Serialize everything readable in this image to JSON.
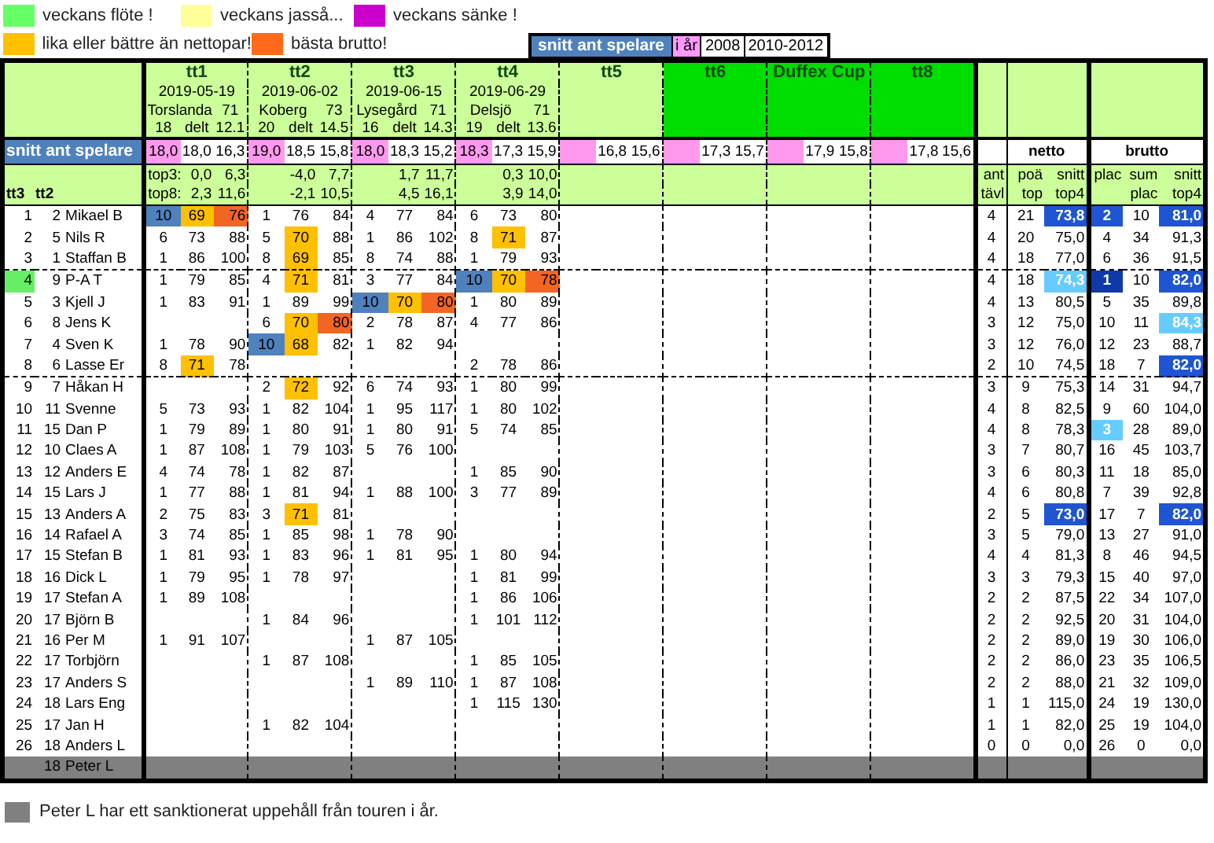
{
  "legend_rows": [
    [
      {
        "label": "veckans flöte !",
        "color": "#66ff66"
      },
      {
        "label": "veckans jasså...",
        "color": "#ffff99"
      },
      {
        "label": "veckans sänke !",
        "color": "#cc00cc"
      }
    ],
    [
      {
        "label": "lika eller bättre än nettopar!",
        "color": "#ffc000"
      },
      {
        "label": "bästa brutto!",
        "color": "#ff6a1a"
      }
    ]
  ],
  "snitt_key": {
    "title": "snitt ant spelare",
    "items": [
      {
        "label": "i år",
        "color": "#ff99ff"
      },
      {
        "label": "2008",
        "color": "#ffffff"
      },
      {
        "label": "2010-2012",
        "color": "#ffffff"
      }
    ]
  },
  "left_header": {
    "snitt_label": "snitt ant spelare",
    "rank_label": "tt3",
    "tt2_label": "tt2"
  },
  "tournaments": [
    {
      "name": "tt1",
      "highlighted": false,
      "date": "2019-05-19",
      "course": "Torslanda",
      "par": "71",
      "players": "18",
      "delt": "delt",
      "hcp": "12.1",
      "snitt_i_ar": "18,0",
      "snitt_2008": "18,0",
      "snitt_2010_2012": "16,3",
      "top3_label": "top3:",
      "top3": [
        "0,0",
        "6,3"
      ],
      "top8_label": "top8:",
      "top8": [
        "2,3",
        "11,6"
      ]
    },
    {
      "name": "tt2",
      "highlighted": false,
      "date": "2019-06-02",
      "course": "Koberg",
      "par": "73",
      "players": "20",
      "delt": "delt",
      "hcp": "14.5",
      "snitt_i_ar": "19,0",
      "snitt_2008": "18,5",
      "snitt_2010_2012": "15,8",
      "top3": [
        "-4,0",
        "7,7"
      ],
      "top8": [
        "-2,1",
        "10,5"
      ]
    },
    {
      "name": "tt3",
      "highlighted": false,
      "date": "2019-06-15",
      "course": "Lysegård",
      "par": "71",
      "players": "16",
      "delt": "delt",
      "hcp": "14.3",
      "snitt_i_ar": "18,0",
      "snitt_2008": "18,3",
      "snitt_2010_2012": "15,2",
      "top3": [
        "1,7",
        "11,7"
      ],
      "top8": [
        "4,5",
        "16,1"
      ]
    },
    {
      "name": "tt4",
      "highlighted": false,
      "date": "2019-06-29",
      "course": "Delsjö",
      "par": "71",
      "players": "19",
      "delt": "delt",
      "hcp": "13.6",
      "snitt_i_ar": "18,3",
      "snitt_2008": "17,3",
      "snitt_2010_2012": "15,9",
      "top3": [
        "0,3",
        "10,0"
      ],
      "top8": [
        "3,9",
        "14,0"
      ]
    },
    {
      "name": "tt5",
      "highlighted": false,
      "snitt_2008": "16,8",
      "snitt_2010_2012": "15,6"
    },
    {
      "name": "tt6",
      "highlighted": true,
      "snitt_2008": "17,3",
      "snitt_2010_2012": "15,7"
    },
    {
      "name": "Duffex Cup",
      "highlighted": true,
      "snitt_2008": "17,9",
      "snitt_2010_2012": "15,8"
    },
    {
      "name": "tt8",
      "highlighted": true,
      "snitt_2008": "17,8",
      "snitt_2010_2012": "15,6"
    }
  ],
  "summary_header": {
    "ant": {
      "top": "ant",
      "bottom": "tävl"
    },
    "netto": {
      "title": "netto",
      "columns": [
        {
          "top": "poä",
          "bottom": "top"
        },
        {
          "top": "snitt",
          "bottom": "top4"
        }
      ]
    },
    "brutto": {
      "title": "brutto",
      "columns": [
        {
          "top": "plac"
        },
        {
          "top": "sum",
          "bottom": "plac"
        },
        {
          "top": "snitt",
          "bottom": "top4"
        }
      ]
    }
  },
  "groups": [
    {
      "rows": [
        {
          "rank": "1",
          "tt2": "2",
          "name": "Mikael B",
          "flote": false,
          "sanctioned": false,
          "results": [
            {
              "kind": "result",
              "place": "10",
              "netto": "69",
              "brutto": "76",
              "top_place": true,
              "under_par": true,
              "best_brutto": true
            },
            {
              "kind": "result",
              "place": "1",
              "netto": "76",
              "brutto": "84",
              "top_place": false,
              "under_par": false,
              "best_brutto": false
            },
            {
              "kind": "result",
              "place": "4",
              "netto": "77",
              "brutto": "84",
              "top_place": false,
              "under_par": false,
              "best_brutto": false
            },
            {
              "kind": "result",
              "place": "6",
              "netto": "73",
              "brutto": "80",
              "top_place": false,
              "under_par": false,
              "best_brutto": false
            }
          ],
          "ant": "4",
          "poa": "21",
          "netto_snitt": {
            "value": "73,8",
            "color": "#1f55d2"
          },
          "plac": {
            "value": "2",
            "color": "#1f55d2"
          },
          "sum_plac": "10",
          "brutto_snitt": {
            "value": "81,0",
            "color": "#1f55d2"
          }
        },
        {
          "rank": "2",
          "tt2": "5",
          "name": "Nils R",
          "flote": false,
          "sanctioned": false,
          "results": [
            {
              "kind": "result",
              "place": "6",
              "netto": "73",
              "brutto": "88",
              "top_place": false,
              "under_par": false,
              "best_brutto": false
            },
            {
              "kind": "result",
              "place": "5",
              "netto": "70",
              "brutto": "88",
              "top_place": false,
              "under_par": true,
              "best_brutto": false
            },
            {
              "kind": "result",
              "place": "1",
              "netto": "86",
              "brutto": "102",
              "top_place": false,
              "under_par": false,
              "best_brutto": false
            },
            {
              "kind": "result",
              "place": "8",
              "netto": "71",
              "brutto": "87",
              "top_place": false,
              "under_par": true,
              "best_brutto": false
            }
          ],
          "ant": "4",
          "poa": "20",
          "netto_snitt": {
            "value": "75,0"
          },
          "plac": {
            "value": "4"
          },
          "sum_plac": "34",
          "brutto_snitt": {
            "value": "91,3"
          }
        },
        {
          "rank": "3",
          "tt2": "1",
          "name": "Staffan B",
          "flote": false,
          "sanctioned": false,
          "results": [
            {
              "kind": "result",
              "place": "1",
              "netto": "86",
              "brutto": "100",
              "top_place": false,
              "under_par": false,
              "best_brutto": false
            },
            {
              "kind": "result",
              "place": "8",
              "netto": "69",
              "brutto": "85",
              "top_place": false,
              "under_par": true,
              "best_brutto": false
            },
            {
              "kind": "result",
              "place": "8",
              "netto": "74",
              "brutto": "88",
              "top_place": false,
              "under_par": false,
              "best_brutto": false
            },
            {
              "kind": "result",
              "place": "1",
              "netto": "79",
              "brutto": "93",
              "top_place": false,
              "under_par": false,
              "best_brutto": false
            }
          ],
          "ant": "4",
          "poa": "18",
          "netto_snitt": {
            "value": "77,0"
          },
          "plac": {
            "value": "6"
          },
          "sum_plac": "36",
          "brutto_snitt": {
            "value": "91,5"
          }
        }
      ]
    },
    {
      "rows": [
        {
          "rank": "4",
          "tt2": "9",
          "name": "P-A T",
          "flote": true,
          "sanctioned": false,
          "results": [
            {
              "kind": "result",
              "place": "1",
              "netto": "79",
              "brutto": "85",
              "top_place": false,
              "under_par": false,
              "best_brutto": false
            },
            {
              "kind": "result",
              "place": "4",
              "netto": "71",
              "brutto": "81",
              "top_place": false,
              "under_par": true,
              "best_brutto": false
            },
            {
              "kind": "result",
              "place": "3",
              "netto": "77",
              "brutto": "84",
              "top_place": false,
              "under_par": false,
              "best_brutto": false
            },
            {
              "kind": "result",
              "place": "10",
              "netto": "70",
              "brutto": "78",
              "top_place": true,
              "under_par": true,
              "best_brutto": true
            }
          ],
          "ant": "4",
          "poa": "18",
          "netto_snitt": {
            "value": "74,3",
            "color": "#66ccff"
          },
          "plac": {
            "value": "1",
            "color": "#0d3aa8"
          },
          "sum_plac": "10",
          "brutto_snitt": {
            "value": "82,0",
            "color": "#1f55d2"
          }
        },
        {
          "rank": "5",
          "tt2": "3",
          "name": "Kjell J",
          "flote": false,
          "sanctioned": false,
          "results": [
            {
              "kind": "result",
              "place": "1",
              "netto": "83",
              "brutto": "91",
              "top_place": false,
              "under_par": false,
              "best_brutto": false
            },
            {
              "kind": "result",
              "place": "1",
              "netto": "89",
              "brutto": "99",
              "top_place": false,
              "under_par": false,
              "best_brutto": false
            },
            {
              "kind": "result",
              "place": "10",
              "netto": "70",
              "brutto": "80",
              "top_place": true,
              "under_par": true,
              "best_brutto": true
            },
            {
              "kind": "result",
              "place": "1",
              "netto": "80",
              "brutto": "89",
              "top_place": false,
              "under_par": false,
              "best_brutto": false
            }
          ],
          "ant": "4",
          "poa": "13",
          "netto_snitt": {
            "value": "80,5"
          },
          "plac": {
            "value": "5"
          },
          "sum_plac": "35",
          "brutto_snitt": {
            "value": "89,8"
          }
        },
        {
          "rank": "6",
          "tt2": "8",
          "name": "Jens K",
          "flote": false,
          "sanctioned": false,
          "results": [
            {
              "kind": "none"
            },
            {
              "kind": "result",
              "place": "6",
              "netto": "70",
              "brutto": "80",
              "top_place": false,
              "under_par": true,
              "best_brutto": true
            },
            {
              "kind": "result",
              "place": "2",
              "netto": "78",
              "brutto": "87",
              "top_place": false,
              "under_par": false,
              "best_brutto": false
            },
            {
              "kind": "result",
              "place": "4",
              "netto": "77",
              "brutto": "86",
              "top_place": false,
              "under_par": false,
              "best_brutto": false
            }
          ],
          "ant": "3",
          "poa": "12",
          "netto_snitt": {
            "value": "75,0"
          },
          "plac": {
            "value": "10"
          },
          "sum_plac": "11",
          "brutto_snitt": {
            "value": "84,3",
            "color": "#66ccff"
          }
        },
        {
          "rank": "7",
          "tt2": "4",
          "name": "Sven K",
          "flote": false,
          "sanctioned": false,
          "results": [
            {
              "kind": "result",
              "place": "1",
              "netto": "78",
              "brutto": "90",
              "top_place": false,
              "under_par": false,
              "best_brutto": false
            },
            {
              "kind": "result",
              "place": "10",
              "netto": "68",
              "brutto": "82",
              "top_place": true,
              "under_par": true,
              "best_brutto": false
            },
            {
              "kind": "result",
              "place": "1",
              "netto": "82",
              "brutto": "94",
              "top_place": false,
              "under_par": false,
              "best_brutto": false
            },
            {
              "kind": "none"
            }
          ],
          "ant": "3",
          "poa": "12",
          "netto_snitt": {
            "value": "76,0"
          },
          "plac": {
            "value": "12"
          },
          "sum_plac": "23",
          "brutto_snitt": {
            "value": "88,7"
          }
        },
        {
          "rank": "8",
          "tt2": "6",
          "name": "Lasse Er",
          "flote": false,
          "sanctioned": false,
          "results": [
            {
              "kind": "result",
              "place": "8",
              "netto": "71",
              "brutto": "78",
              "top_place": false,
              "under_par": true,
              "best_brutto": false
            },
            {
              "kind": "none"
            },
            {
              "kind": "none"
            },
            {
              "kind": "result",
              "place": "2",
              "netto": "78",
              "brutto": "86",
              "top_place": false,
              "under_par": false,
              "best_brutto": false
            }
          ],
          "ant": "2",
          "poa": "10",
          "netto_snitt": {
            "value": "74,5"
          },
          "plac": {
            "value": "18"
          },
          "sum_plac": "7",
          "brutto_snitt": {
            "value": "82,0",
            "color": "#1f55d2"
          }
        }
      ]
    },
    {
      "rows": [
        {
          "rank": "9",
          "tt2": "7",
          "name": "Håkan H",
          "flote": false,
          "sanctioned": false,
          "results": [
            {
              "kind": "none"
            },
            {
              "kind": "result",
              "place": "2",
              "netto": "72",
              "brutto": "92",
              "top_place": false,
              "under_par": true,
              "best_brutto": false
            },
            {
              "kind": "result",
              "place": "6",
              "netto": "74",
              "brutto": "93",
              "top_place": false,
              "under_par": false,
              "best_brutto": false
            },
            {
              "kind": "result",
              "place": "1",
              "netto": "80",
              "brutto": "99",
              "top_place": false,
              "under_par": false,
              "best_brutto": false
            }
          ],
          "ant": "3",
          "poa": "9",
          "netto_snitt": {
            "value": "75,3"
          },
          "plac": {
            "value": "14"
          },
          "sum_plac": "31",
          "brutto_snitt": {
            "value": "94,7"
          }
        },
        {
          "rank": "10",
          "tt2": "11",
          "name": "Svenne",
          "flote": false,
          "sanctioned": false,
          "results": [
            {
              "kind": "result",
              "place": "5",
              "netto": "73",
              "brutto": "93",
              "top_place": false,
              "under_par": false,
              "best_brutto": false
            },
            {
              "kind": "result",
              "place": "1",
              "netto": "82",
              "brutto": "104",
              "top_place": false,
              "under_par": false,
              "best_brutto": false
            },
            {
              "kind": "result",
              "place": "1",
              "netto": "95",
              "brutto": "117",
              "top_place": false,
              "under_par": false,
              "best_brutto": false
            },
            {
              "kind": "result",
              "place": "1",
              "netto": "80",
              "brutto": "102",
              "top_place": false,
              "under_par": false,
              "best_brutto": false
            }
          ],
          "ant": "4",
          "poa": "8",
          "netto_snitt": {
            "value": "82,5"
          },
          "plac": {
            "value": "9"
          },
          "sum_plac": "60",
          "brutto_snitt": {
            "value": "104,0"
          }
        },
        {
          "rank": "11",
          "tt2": "15",
          "name": "Dan P",
          "flote": false,
          "sanctioned": false,
          "results": [
            {
              "kind": "result",
              "place": "1",
              "netto": "79",
              "brutto": "89",
              "top_place": false,
              "under_par": false,
              "best_brutto": false
            },
            {
              "kind": "result",
              "place": "1",
              "netto": "80",
              "brutto": "91",
              "top_place": false,
              "under_par": false,
              "best_brutto": false
            },
            {
              "kind": "result",
              "place": "1",
              "netto": "80",
              "brutto": "91",
              "top_place": false,
              "under_par": false,
              "best_brutto": false
            },
            {
              "kind": "result",
              "place": "5",
              "netto": "74",
              "brutto": "85",
              "top_place": false,
              "under_par": false,
              "best_brutto": false
            }
          ],
          "ant": "4",
          "poa": "8",
          "netto_snitt": {
            "value": "78,3"
          },
          "plac": {
            "value": "3",
            "color": "#66ccff"
          },
          "sum_plac": "28",
          "brutto_snitt": {
            "value": "89,0"
          }
        },
        {
          "rank": "12",
          "tt2": "10",
          "name": "Claes A",
          "flote": false,
          "sanctioned": false,
          "results": [
            {
              "kind": "result",
              "place": "1",
              "netto": "87",
              "brutto": "108",
              "top_place": false,
              "under_par": false,
              "best_brutto": false
            },
            {
              "kind": "result",
              "place": "1",
              "netto": "79",
              "brutto": "103",
              "top_place": false,
              "under_par": false,
              "best_brutto": false
            },
            {
              "kind": "result",
              "place": "5",
              "netto": "76",
              "brutto": "100",
              "top_place": false,
              "under_par": false,
              "best_brutto": false
            },
            {
              "kind": "none"
            }
          ],
          "ant": "3",
          "poa": "7",
          "netto_snitt": {
            "value": "80,7"
          },
          "plac": {
            "value": "16"
          },
          "sum_plac": "45",
          "brutto_snitt": {
            "value": "103,7"
          }
        },
        {
          "rank": "13",
          "tt2": "12",
          "name": "Anders E",
          "flote": false,
          "sanctioned": false,
          "results": [
            {
              "kind": "result",
              "place": "4",
              "netto": "74",
              "brutto": "78",
              "top_place": false,
              "under_par": false,
              "best_brutto": false
            },
            {
              "kind": "result",
              "place": "1",
              "netto": "82",
              "brutto": "87",
              "top_place": false,
              "under_par": false,
              "best_brutto": false
            },
            {
              "kind": "none"
            },
            {
              "kind": "result",
              "place": "1",
              "netto": "85",
              "brutto": "90",
              "top_place": false,
              "under_par": false,
              "best_brutto": false
            }
          ],
          "ant": "3",
          "poa": "6",
          "netto_snitt": {
            "value": "80,3"
          },
          "plac": {
            "value": "11"
          },
          "sum_plac": "18",
          "brutto_snitt": {
            "value": "85,0"
          }
        },
        {
          "rank": "14",
          "tt2": "15",
          "name": "Lars J",
          "flote": false,
          "sanctioned": false,
          "results": [
            {
              "kind": "result",
              "place": "1",
              "netto": "77",
              "brutto": "88",
              "top_place": false,
              "under_par": false,
              "best_brutto": false
            },
            {
              "kind": "result",
              "place": "1",
              "netto": "81",
              "brutto": "94",
              "top_place": false,
              "under_par": false,
              "best_brutto": false
            },
            {
              "kind": "result",
              "place": "1",
              "netto": "88",
              "brutto": "100",
              "top_place": false,
              "under_par": false,
              "best_brutto": false
            },
            {
              "kind": "result",
              "place": "3",
              "netto": "77",
              "brutto": "89",
              "top_place": false,
              "under_par": false,
              "best_brutto": false
            }
          ],
          "ant": "4",
          "poa": "6",
          "netto_snitt": {
            "value": "80,8"
          },
          "plac": {
            "value": "7"
          },
          "sum_plac": "39",
          "brutto_snitt": {
            "value": "92,8"
          }
        },
        {
          "rank": "15",
          "tt2": "13",
          "name": "Anders A",
          "flote": false,
          "sanctioned": false,
          "results": [
            {
              "kind": "result",
              "place": "2",
              "netto": "75",
              "brutto": "83",
              "top_place": false,
              "under_par": false,
              "best_brutto": false
            },
            {
              "kind": "result",
              "place": "3",
              "netto": "71",
              "brutto": "81",
              "top_place": false,
              "under_par": true,
              "best_brutto": false
            },
            {
              "kind": "none"
            },
            {
              "kind": "none"
            }
          ],
          "ant": "2",
          "poa": "5",
          "netto_snitt": {
            "value": "73,0",
            "color": "#1f55d2"
          },
          "plac": {
            "value": "17"
          },
          "sum_plac": "7",
          "brutto_snitt": {
            "value": "82,0",
            "color": "#1f55d2"
          }
        },
        {
          "rank": "16",
          "tt2": "14",
          "name": "Rafael A",
          "flote": false,
          "sanctioned": false,
          "results": [
            {
              "kind": "result",
              "place": "3",
              "netto": "74",
              "brutto": "85",
              "top_place": false,
              "under_par": false,
              "best_brutto": false
            },
            {
              "kind": "result",
              "place": "1",
              "netto": "85",
              "brutto": "98",
              "top_place": false,
              "under_par": false,
              "best_brutto": false
            },
            {
              "kind": "result",
              "place": "1",
              "netto": "78",
              "brutto": "90",
              "top_place": false,
              "under_par": false,
              "best_brutto": false
            },
            {
              "kind": "none"
            }
          ],
          "ant": "3",
          "poa": "5",
          "netto_snitt": {
            "value": "79,0"
          },
          "plac": {
            "value": "13"
          },
          "sum_plac": "27",
          "brutto_snitt": {
            "value": "91,0"
          }
        },
        {
          "rank": "17",
          "tt2": "15",
          "name": "Stefan B",
          "flote": false,
          "sanctioned": false,
          "results": [
            {
              "kind": "result",
              "place": "1",
              "netto": "81",
              "brutto": "93",
              "top_place": false,
              "under_par": false,
              "best_brutto": false
            },
            {
              "kind": "result",
              "place": "1",
              "netto": "83",
              "brutto": "96",
              "top_place": false,
              "under_par": false,
              "best_brutto": false
            },
            {
              "kind": "result",
              "place": "1",
              "netto": "81",
              "brutto": "95",
              "top_place": false,
              "under_par": false,
              "best_brutto": false
            },
            {
              "kind": "result",
              "place": "1",
              "netto": "80",
              "brutto": "94",
              "top_place": false,
              "under_par": false,
              "best_brutto": false
            }
          ],
          "ant": "4",
          "poa": "4",
          "netto_snitt": {
            "value": "81,3"
          },
          "plac": {
            "value": "8"
          },
          "sum_plac": "46",
          "brutto_snitt": {
            "value": "94,5"
          }
        },
        {
          "rank": "18",
          "tt2": "16",
          "name": "Dick L",
          "flote": false,
          "sanctioned": false,
          "results": [
            {
              "kind": "result",
              "place": "1",
              "netto": "79",
              "brutto": "95",
              "top_place": false,
              "under_par": false,
              "best_brutto": false
            },
            {
              "kind": "result",
              "place": "1",
              "netto": "78",
              "brutto": "97",
              "top_place": false,
              "under_par": false,
              "best_brutto": false
            },
            {
              "kind": "none"
            },
            {
              "kind": "result",
              "place": "1",
              "netto": "81",
              "brutto": "99",
              "top_place": false,
              "under_par": false,
              "best_brutto": false
            }
          ],
          "ant": "3",
          "poa": "3",
          "netto_snitt": {
            "value": "79,3"
          },
          "plac": {
            "value": "15"
          },
          "sum_plac": "40",
          "brutto_snitt": {
            "value": "97,0"
          }
        },
        {
          "rank": "19",
          "tt2": "17",
          "name": "Stefan A",
          "flote": false,
          "sanctioned": false,
          "results": [
            {
              "kind": "result",
              "place": "1",
              "netto": "89",
              "brutto": "108",
              "top_place": false,
              "under_par": false,
              "best_brutto": false
            },
            {
              "kind": "none"
            },
            {
              "kind": "none"
            },
            {
              "kind": "result",
              "place": "1",
              "netto": "86",
              "brutto": "106",
              "top_place": false,
              "under_par": false,
              "best_brutto": false
            }
          ],
          "ant": "2",
          "poa": "2",
          "netto_snitt": {
            "value": "87,5"
          },
          "plac": {
            "value": "22"
          },
          "sum_plac": "34",
          "brutto_snitt": {
            "value": "107,0"
          }
        },
        {
          "rank": "20",
          "tt2": "17",
          "name": "Björn B",
          "flote": false,
          "sanctioned": false,
          "results": [
            {
              "kind": "none"
            },
            {
              "kind": "result",
              "place": "1",
              "netto": "84",
              "brutto": "96",
              "top_place": false,
              "under_par": false,
              "best_brutto": false
            },
            {
              "kind": "none"
            },
            {
              "kind": "result",
              "place": "1",
              "netto": "101",
              "brutto": "112",
              "top_place": false,
              "under_par": false,
              "best_brutto": false
            }
          ],
          "ant": "2",
          "poa": "2",
          "netto_snitt": {
            "value": "92,5"
          },
          "plac": {
            "value": "20"
          },
          "sum_plac": "31",
          "brutto_snitt": {
            "value": "104,0"
          }
        },
        {
          "rank": "21",
          "tt2": "16",
          "name": "Per M",
          "flote": false,
          "sanctioned": false,
          "results": [
            {
              "kind": "result",
              "place": "1",
              "netto": "91",
              "brutto": "107",
              "top_place": false,
              "under_par": false,
              "best_brutto": false
            },
            {
              "kind": "none"
            },
            {
              "kind": "result",
              "place": "1",
              "netto": "87",
              "brutto": "105",
              "top_place": false,
              "under_par": false,
              "best_brutto": false
            },
            {
              "kind": "none"
            }
          ],
          "ant": "2",
          "poa": "2",
          "netto_snitt": {
            "value": "89,0"
          },
          "plac": {
            "value": "19"
          },
          "sum_plac": "30",
          "brutto_snitt": {
            "value": "106,0"
          }
        },
        {
          "rank": "22",
          "tt2": "17",
          "name": "Torbjörn",
          "flote": false,
          "sanctioned": false,
          "results": [
            {
              "kind": "none"
            },
            {
              "kind": "result",
              "place": "1",
              "netto": "87",
              "brutto": "108",
              "top_place": false,
              "under_par": false,
              "best_brutto": false
            },
            {
              "kind": "none"
            },
            {
              "kind": "result",
              "place": "1",
              "netto": "85",
              "brutto": "105",
              "top_place": false,
              "under_par": false,
              "best_brutto": false
            }
          ],
          "ant": "2",
          "poa": "2",
          "netto_snitt": {
            "value": "86,0"
          },
          "plac": {
            "value": "23"
          },
          "sum_plac": "35",
          "brutto_snitt": {
            "value": "106,5"
          }
        },
        {
          "rank": "23",
          "tt2": "17",
          "name": "Anders S",
          "flote": false,
          "sanctioned": false,
          "results": [
            {
              "kind": "none"
            },
            {
              "kind": "none"
            },
            {
              "kind": "result",
              "place": "1",
              "netto": "89",
              "brutto": "110",
              "top_place": false,
              "under_par": false,
              "best_brutto": false
            },
            {
              "kind": "result",
              "place": "1",
              "netto": "87",
              "brutto": "108",
              "top_place": false,
              "under_par": false,
              "best_brutto": false
            }
          ],
          "ant": "2",
          "poa": "2",
          "netto_snitt": {
            "value": "88,0"
          },
          "plac": {
            "value": "21"
          },
          "sum_plac": "32",
          "brutto_snitt": {
            "value": "109,0"
          }
        },
        {
          "rank": "24",
          "tt2": "18",
          "name": "Lars Eng",
          "flote": false,
          "sanctioned": false,
          "results": [
            {
              "kind": "none"
            },
            {
              "kind": "none"
            },
            {
              "kind": "none"
            },
            {
              "kind": "result",
              "place": "1",
              "netto": "115",
              "brutto": "130",
              "top_place": false,
              "under_par": false,
              "best_brutto": false
            }
          ],
          "ant": "1",
          "poa": "1",
          "netto_snitt": {
            "value": "115,0"
          },
          "plac": {
            "value": "24"
          },
          "sum_plac": "19",
          "brutto_snitt": {
            "value": "130,0"
          }
        },
        {
          "rank": "25",
          "tt2": "17",
          "name": "Jan H",
          "flote": false,
          "sanctioned": false,
          "results": [
            {
              "kind": "none"
            },
            {
              "kind": "result",
              "place": "1",
              "netto": "82",
              "brutto": "104",
              "top_place": false,
              "under_par": false,
              "best_brutto": false
            },
            {
              "kind": "none"
            },
            {
              "kind": "none"
            }
          ],
          "ant": "1",
          "poa": "1",
          "netto_snitt": {
            "value": "82,0"
          },
          "plac": {
            "value": "25"
          },
          "sum_plac": "19",
          "brutto_snitt": {
            "value": "104,0"
          }
        },
        {
          "rank": "26",
          "tt2": "18",
          "name": "Anders L",
          "flote": false,
          "sanctioned": false,
          "ant": "0",
          "poa": "0",
          "netto_snitt": {
            "value": "0,0"
          },
          "plac": {
            "value": "26"
          },
          "sum_plac": "0",
          "brutto_snitt": {
            "value": "0,0"
          }
        },
        {
          "tt2": "18",
          "name": "Peter L",
          "flote": false,
          "sanctioned": true
        }
      ]
    }
  ],
  "footer": {
    "color": "#808080",
    "text": "Peter L har ett sanktionerat uppehåll från touren i år."
  }
}
